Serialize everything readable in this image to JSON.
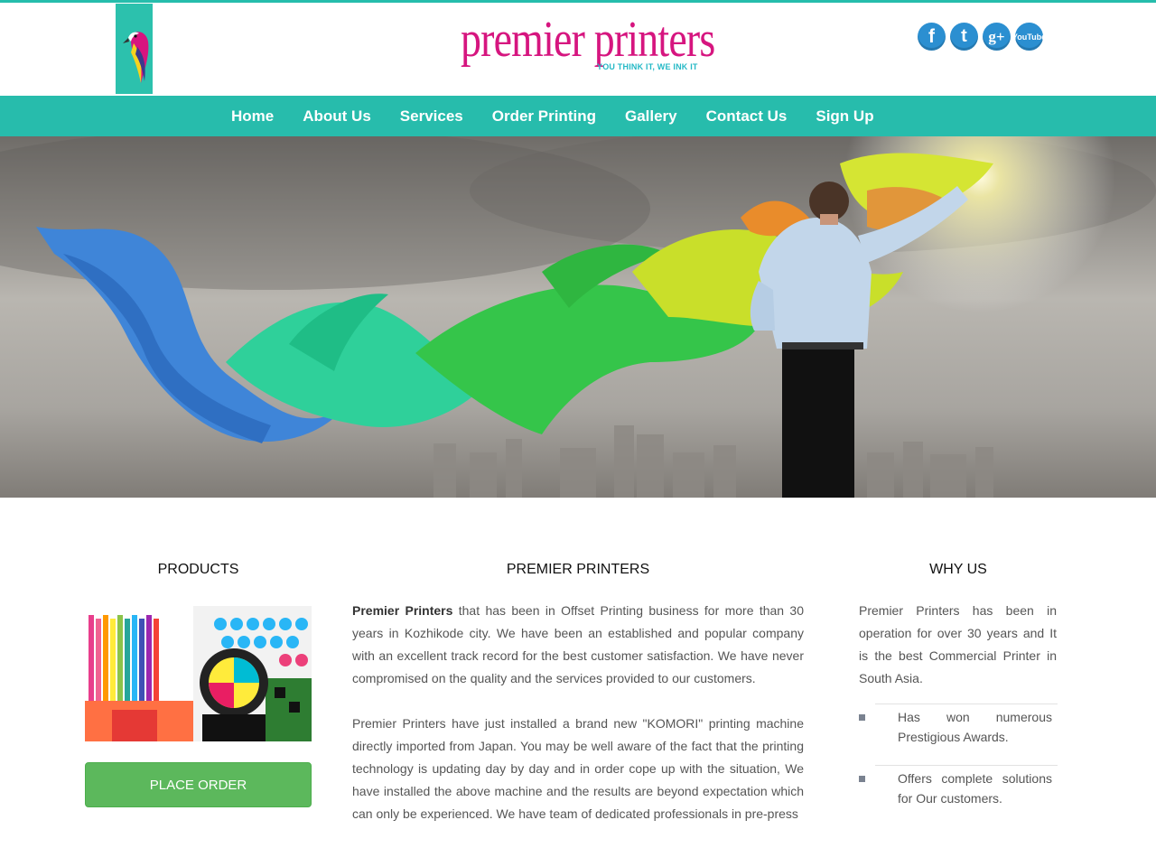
{
  "brand": {
    "name": "premier printers",
    "tagline": "YOU THINK IT, WE INK IT"
  },
  "social": [
    {
      "icon": "facebook-icon",
      "glyph": "f"
    },
    {
      "icon": "twitter-icon",
      "glyph": "t"
    },
    {
      "icon": "google-plus-icon",
      "glyph": "g+"
    },
    {
      "icon": "youtube-icon",
      "glyph": "YouTube"
    }
  ],
  "nav": {
    "items": [
      "Home",
      "About Us",
      "Services",
      "Order Printing",
      "Gallery",
      "Contact Us",
      "Sign Up"
    ]
  },
  "products": {
    "title": "PRODUCTS",
    "button": "PLACE ORDER"
  },
  "about": {
    "title": "PREMIER PRINTERS",
    "p1_bold": "Premier Printers",
    "p1_rest": " that has been in Offset Printing business for more than 30 years in Kozhikode city. We have been an established and popular company with an excellent track record for the best customer satisfaction. We have never compromised on the quality and the services provided to our customers.",
    "p2": "Premier Printers have just installed a brand new \"KOMORI\" printing machine directly imported from Japan. You may be well aware of the fact that the printing technology is updating day by day and in order cope up with the situation, We have installed the above machine and the results are beyond expectation which can only be experienced. We have team of dedicated professionals in pre-press"
  },
  "why": {
    "title": "WHY US",
    "intro": "Premier Printers has been in operation for over 30 years and It is the best Commercial Printer in South Asia.",
    "items": [
      "Has won numerous Prestigious Awards.",
      "Offers complete solutions for Our customers."
    ]
  },
  "colors": {
    "accent": "#27bcac",
    "brand": "#d6157f",
    "button": "#5cb85c",
    "social": "#2b8fd1"
  }
}
